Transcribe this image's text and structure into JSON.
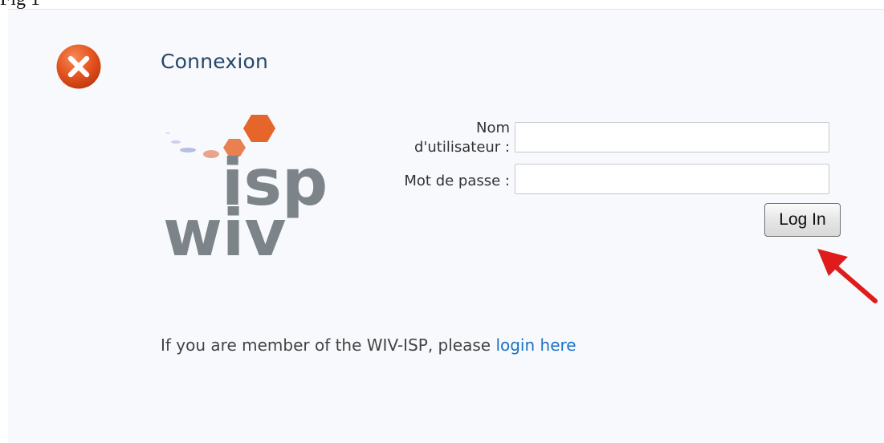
{
  "figure": {
    "caption": "Fig 1"
  },
  "dialog": {
    "title": "Connexion",
    "close_icon": "close-icon",
    "logo": {
      "word_top": "isp",
      "word_bottom": "wiv",
      "accent_color": "#e5652a",
      "text_color": "#7d8489"
    },
    "form": {
      "username_label_line1": "Nom",
      "username_label_line2": "d'utilisateur :",
      "username_value": "",
      "password_label": "Mot de passe :",
      "password_value": "",
      "login_button": "Log In"
    },
    "member_text": "If you are member of the WIV-ISP, please ",
    "member_link": "login here"
  },
  "colors": {
    "panel_bg": "#f7f9fc",
    "title": "#27476a",
    "link": "#1b73c7",
    "close_button": "#e5531f",
    "arrow": "#e01b1b"
  }
}
